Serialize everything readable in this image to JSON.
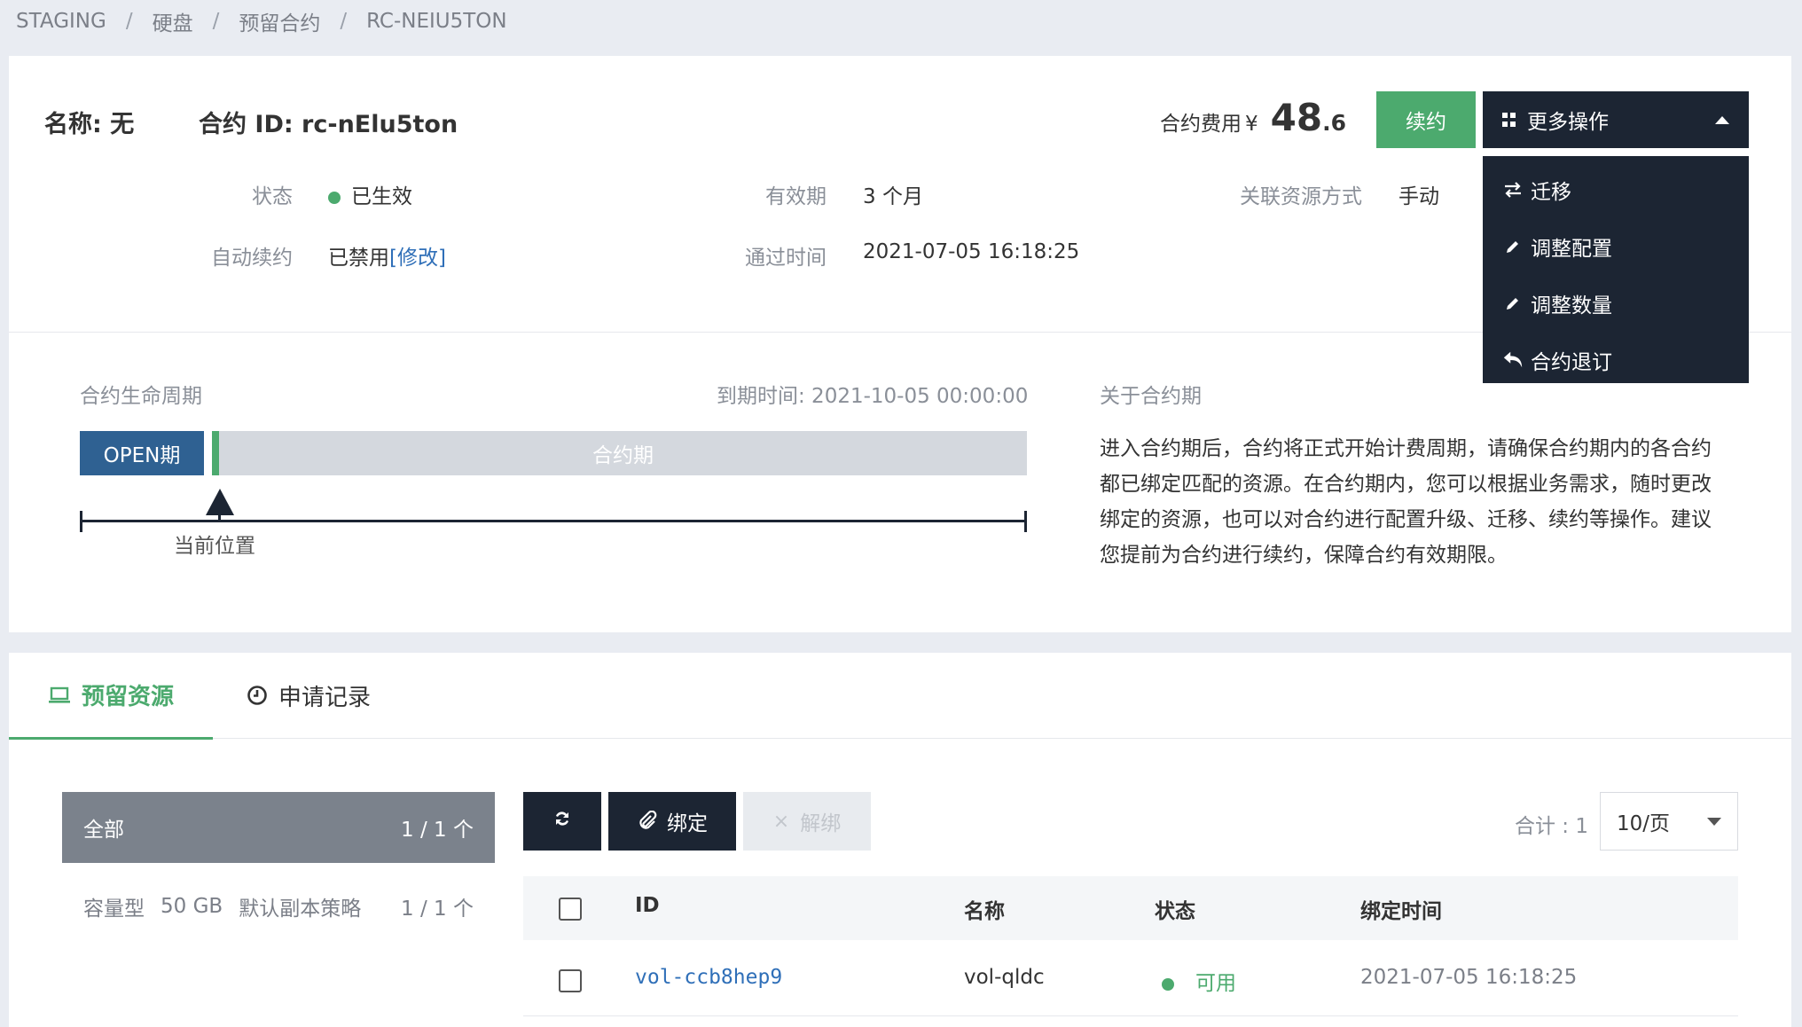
{
  "breadcrumb": [
    "STAGING",
    "硬盘",
    "预留合约",
    "RC-NEIU5TON"
  ],
  "header": {
    "name_label": "名称: 无",
    "contract_id_label": "合约 ID: rc-nElu5ton",
    "fee_label": "合约费用",
    "fee_currency": "¥",
    "fee_int": "48",
    "fee_dec": ".6",
    "renew_label": "续约",
    "more_label": "更多操作"
  },
  "dropdown": [
    {
      "label": "迁移",
      "icon": "swap-icon"
    },
    {
      "label": "调整配置",
      "icon": "pencil-icon"
    },
    {
      "label": "调整数量",
      "icon": "pencil-icon"
    },
    {
      "label": "合约退订",
      "icon": "undo-icon"
    }
  ],
  "fields": {
    "status_label": "状态",
    "status_value": "已生效",
    "validity_label": "有效期",
    "validity_value": "3 个月",
    "assoc_label": "关联资源方式",
    "assoc_value": "手动",
    "auto_renew_label": "自动续约",
    "auto_renew_value": "已禁用",
    "auto_renew_link": "[修改]",
    "passed_label": "通过时间",
    "passed_value": "2021-07-05 16:18:25"
  },
  "lifecycle": {
    "title": "合约生命周期",
    "expire": "到期时间: 2021-10-05 00:00:00",
    "open_label": "OPEN期",
    "period_label": "合约期",
    "current_label": "当前位置"
  },
  "about": {
    "title": "关于合约期",
    "text": "进入合约期后，合约将正式开始计费周期，请确保合约期内的各合约都已绑定匹配的资源。在合约期内，您可以根据业务需求，随时更改绑定的资源，也可以对合约进行配置升级、迁移、续约等操作。建议您提前为合约进行续约，保障合约有效期限。"
  },
  "tabs": {
    "resources": "预留资源",
    "records": "申请记录"
  },
  "sidebar": {
    "all_label": "全部",
    "all_count": "1 / 1 个",
    "item_type": "容量型",
    "item_size": "50 GB",
    "item_policy": "默认副本策略",
    "item_count": "1 / 1 个"
  },
  "toolbar": {
    "bind_label": "绑定",
    "unbind_label": "解绑",
    "total_label": "合计 : 1",
    "page_size": "10/页"
  },
  "table": {
    "headers": [
      "ID",
      "名称",
      "状态",
      "绑定时间"
    ],
    "rows": [
      {
        "id": "vol-ccb8hep9",
        "name": "vol-qldc",
        "status": "可用",
        "bind_time": "2021-07-05 16:18:25"
      }
    ]
  },
  "colors": {
    "green": "#4caa6e",
    "dark": "#1c2533",
    "blue": "#2f6192",
    "link": "#2f6fb8"
  }
}
